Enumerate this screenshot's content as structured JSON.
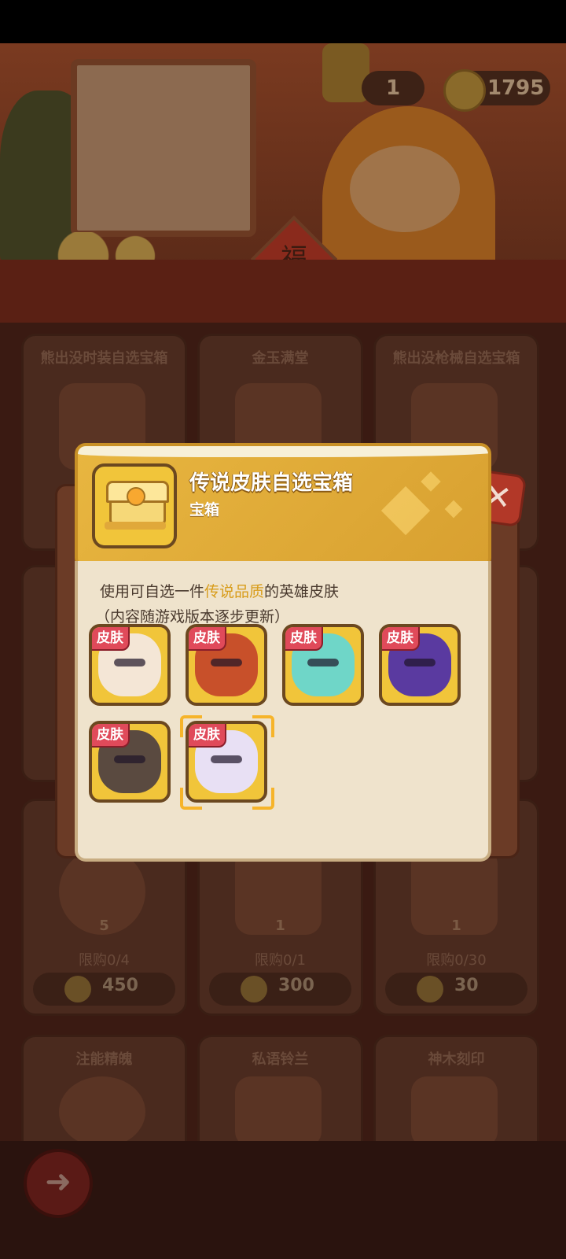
{
  "hud": {
    "gems": "1",
    "gold": "1795"
  },
  "scene": {
    "fu_char": "福"
  },
  "shop": {
    "cards": [
      {
        "title": "熊出没时装自选宝箱",
        "qty": "",
        "limit": "",
        "price": ""
      },
      {
        "title": "金玉满堂",
        "qty": "",
        "limit": "",
        "price": ""
      },
      {
        "title": "熊出没枪械自选宝箱",
        "qty": "",
        "limit": "",
        "price": ""
      },
      {
        "title": "",
        "qty": "5",
        "limit": "限购0/4",
        "price": "450"
      },
      {
        "title": "",
        "qty": "1",
        "limit": "限购0/1",
        "price": "300"
      },
      {
        "title": "",
        "qty": "1",
        "limit": "限购0/30",
        "price": "30"
      },
      {
        "title": "注能精魄",
        "qty": "",
        "limit": "",
        "price": ""
      },
      {
        "title": "私语铃兰",
        "qty": "",
        "limit": "",
        "price": ""
      },
      {
        "title": "神木刻印",
        "qty": "",
        "limit": "",
        "price": ""
      }
    ]
  },
  "dialog": {
    "item_name": "传说皮肤自选宝箱",
    "item_type": "宝箱",
    "desc_prefix": "使用可自选一件",
    "desc_highlight": "传说品质",
    "desc_suffix": "的英雄皮肤",
    "desc_line2": "（内容随游戏版本逐步更新）",
    "close_symbol": "✕",
    "skins": [
      {
        "tag": "皮肤",
        "color": "#f4e6d6",
        "selected": false
      },
      {
        "tag": "皮肤",
        "color": "#c8502a",
        "selected": false
      },
      {
        "tag": "皮肤",
        "color": "#6fd6c8",
        "selected": false
      },
      {
        "tag": "皮肤",
        "color": "#5a3aa0",
        "selected": false
      },
      {
        "tag": "皮肤",
        "color": "#5a4a40",
        "selected": false
      },
      {
        "tag": "皮肤",
        "color": "#e8e0f4",
        "selected": true
      }
    ]
  },
  "nav": {
    "back_symbol": "➜"
  }
}
